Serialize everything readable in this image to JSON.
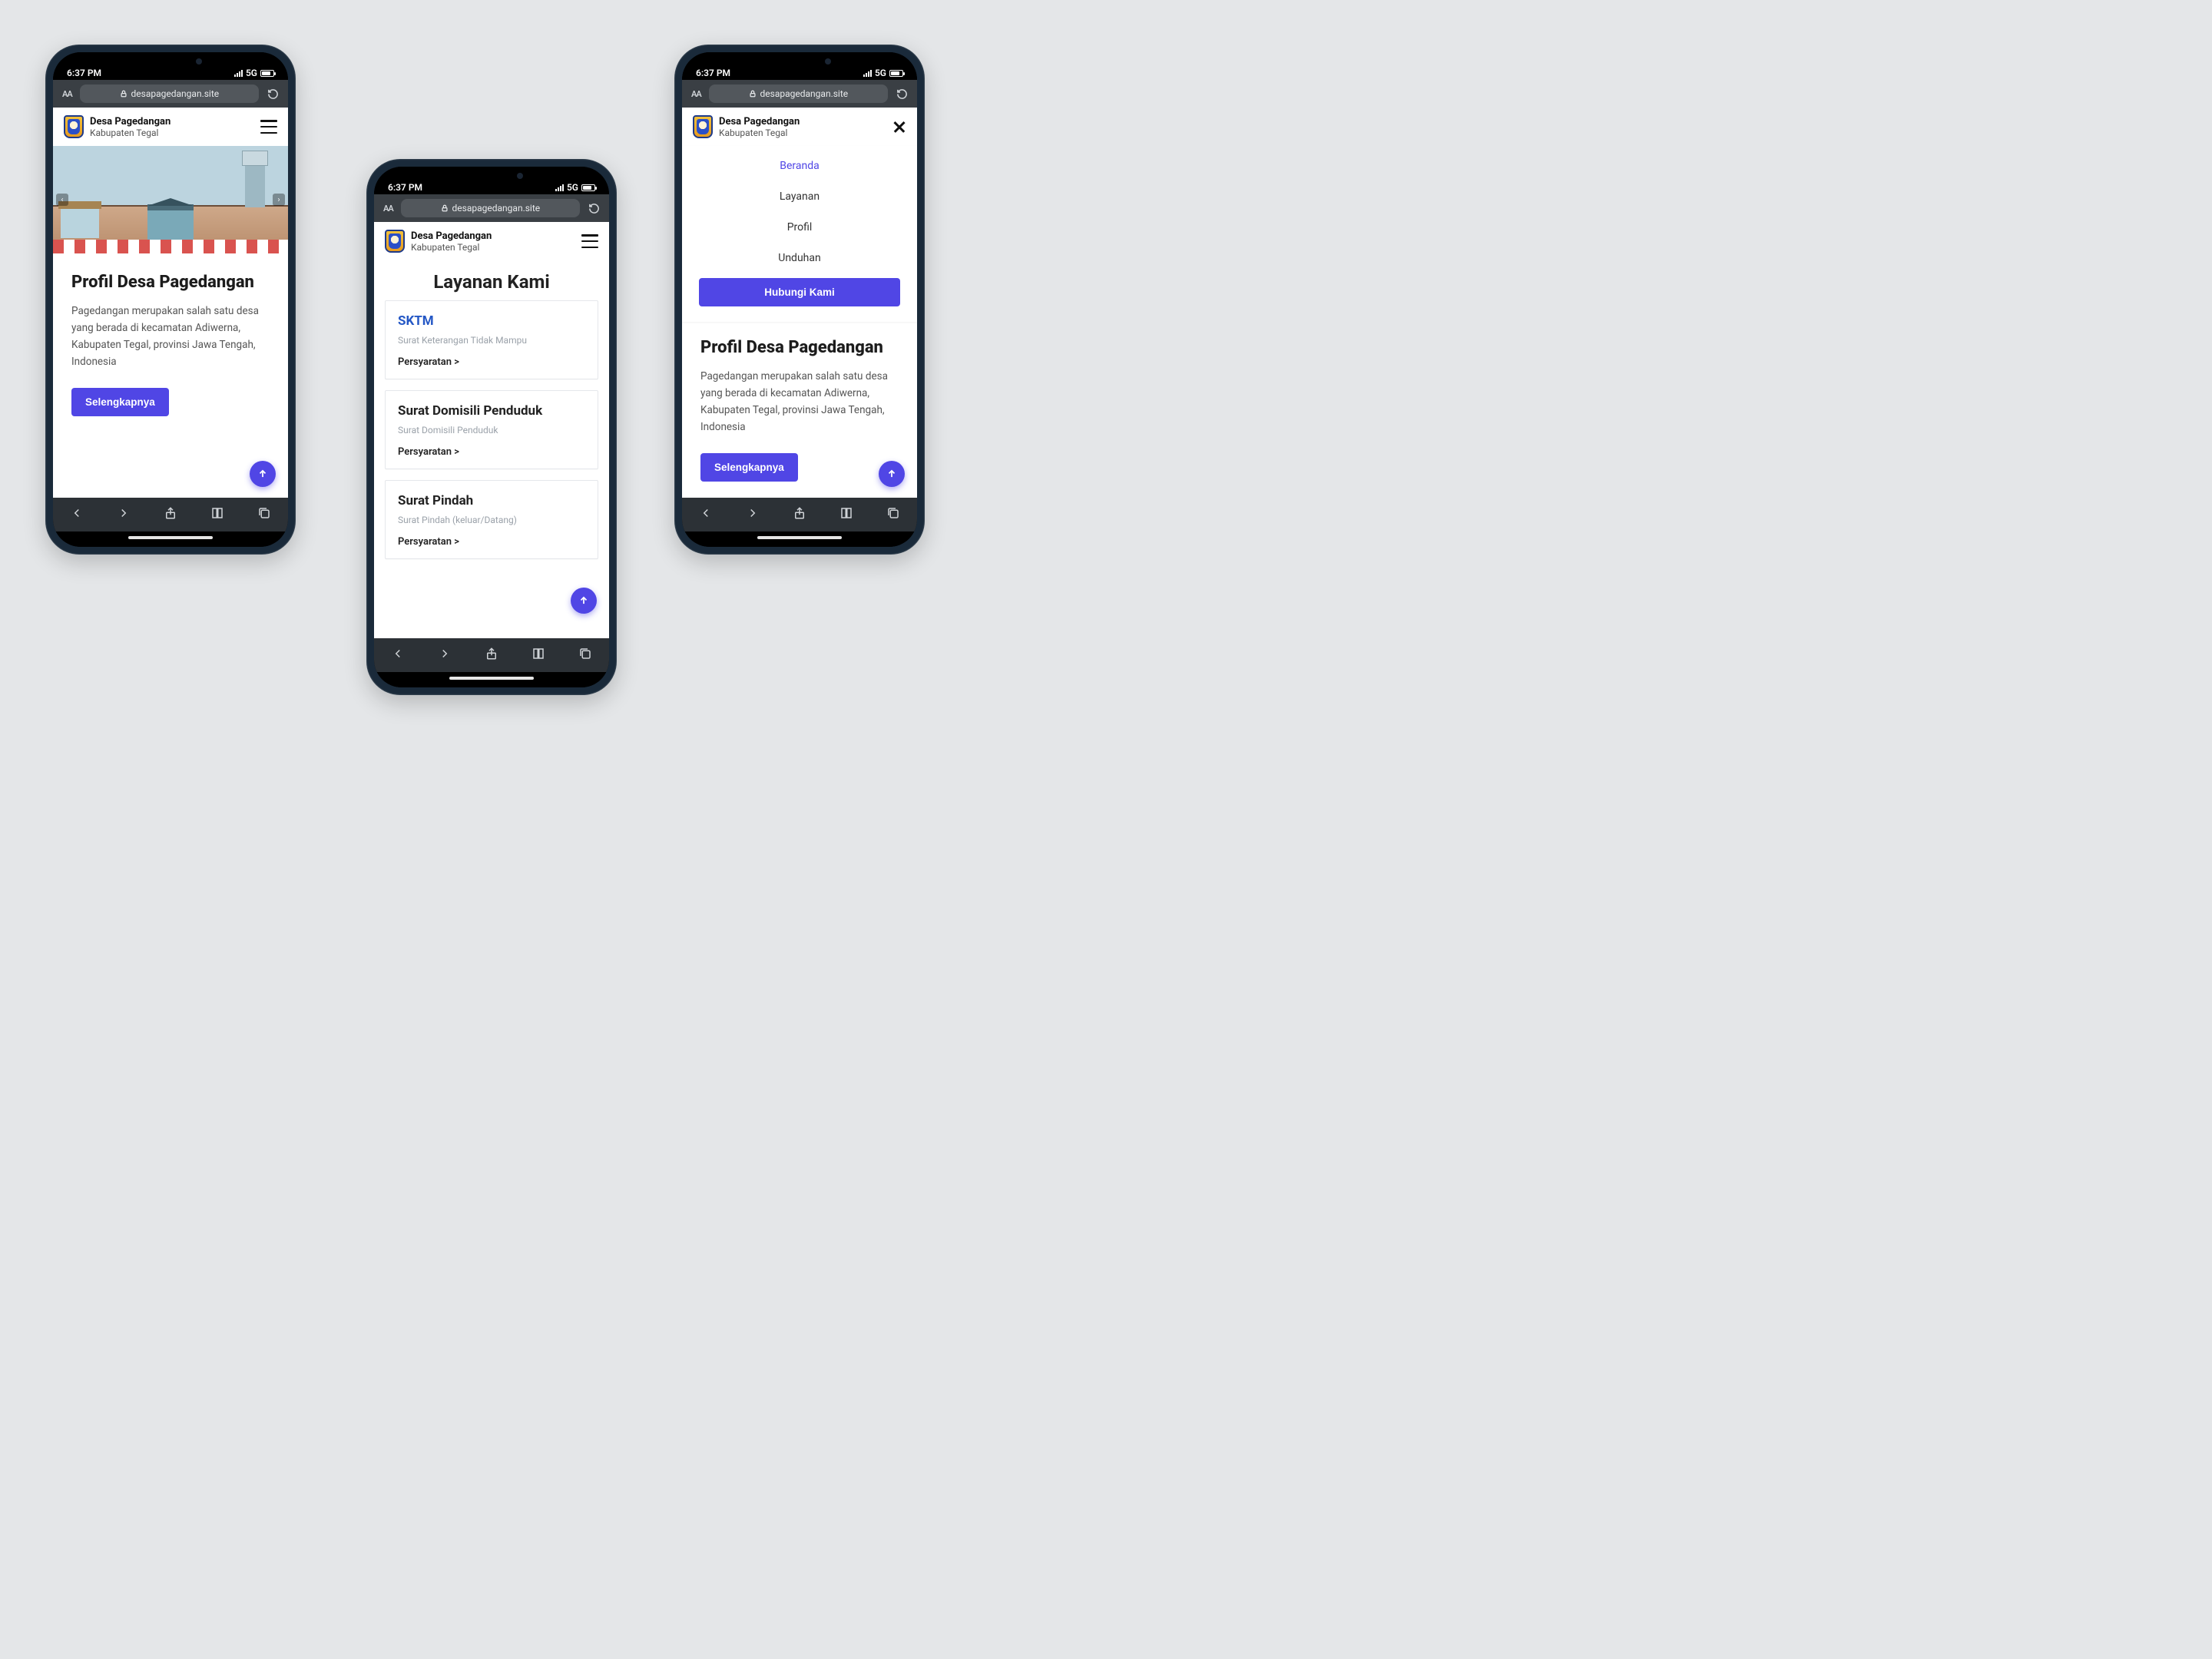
{
  "status": {
    "time": "6:37 PM",
    "network": "5G"
  },
  "browser": {
    "aa": "AA",
    "url": "desapagedangan.site"
  },
  "site": {
    "name": "Desa Pagedangan",
    "region": "Kabupaten Tegal"
  },
  "profile": {
    "heading": "Profil Desa Pagedangan",
    "body": "Pagedangan merupakan salah satu desa yang berada di kecamatan Adiwerna, Kabupaten Tegal, provinsi Jawa Tengah, Indonesia",
    "cta": "Selengkapnya"
  },
  "layanan": {
    "heading": "Layanan Kami",
    "persyaratan": "Persyaratan >",
    "cards": [
      {
        "title": "SKTM",
        "subtitle": "Surat Keterangan Tidak Mampu",
        "link": true
      },
      {
        "title": "Surat Domisili Penduduk",
        "subtitle": "Surat Domisili Penduduk",
        "link": false
      },
      {
        "title": "Surat Pindah",
        "subtitle": "Surat Pindah (keluar/Datang)",
        "link": false
      }
    ]
  },
  "menu": {
    "items": [
      "Beranda",
      "Layanan",
      "Profil",
      "Unduhan"
    ],
    "activeIndex": 0,
    "cta": "Hubungi Kami"
  }
}
